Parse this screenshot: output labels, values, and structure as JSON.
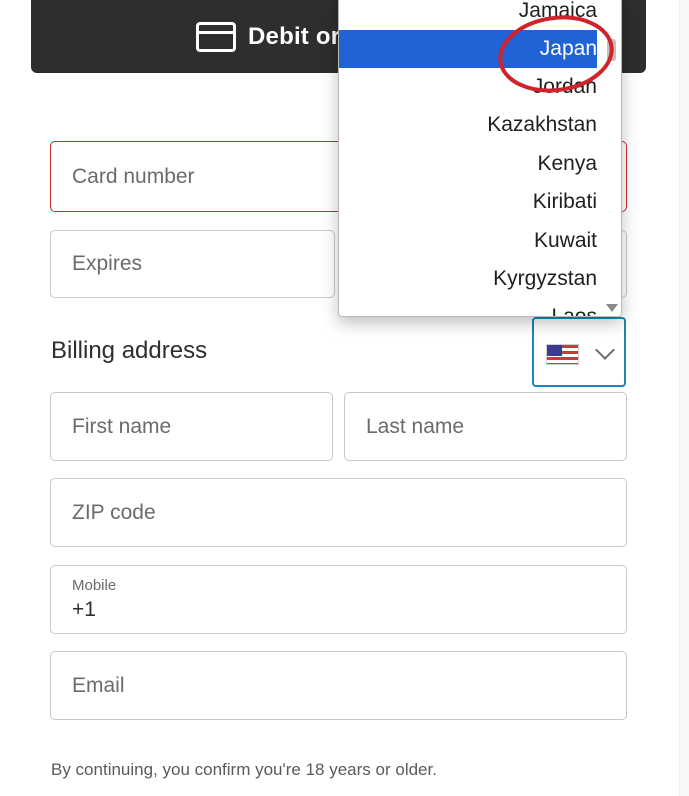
{
  "payment_button": {
    "label": "Debit or"
  },
  "card": {
    "card_number_placeholder": "Card number",
    "expires_placeholder": "Expires"
  },
  "billing": {
    "title": "Billing address",
    "country_flag": "us-flag",
    "first_name_placeholder": "First name",
    "last_name_placeholder": "Last name",
    "zip_placeholder": "ZIP code",
    "mobile_label": "Mobile",
    "mobile_value": "+1",
    "email_placeholder": "Email"
  },
  "disclaimer": "By continuing, you confirm you're 18 years or older.",
  "country_dropdown": {
    "selected": "Japan",
    "items": [
      "Jamaica",
      "Japan",
      "Jordan",
      "Kazakhstan",
      "Kenya",
      "Kiribati",
      "Kuwait",
      "Kyrgyzstan",
      "Laos"
    ]
  },
  "colors": {
    "button_dark": "#2c2e2f",
    "error_border": "#c72e2e",
    "focus_border": "#1a86b9",
    "selected_item": "#1f63d6",
    "annotation": "#d2232a"
  }
}
